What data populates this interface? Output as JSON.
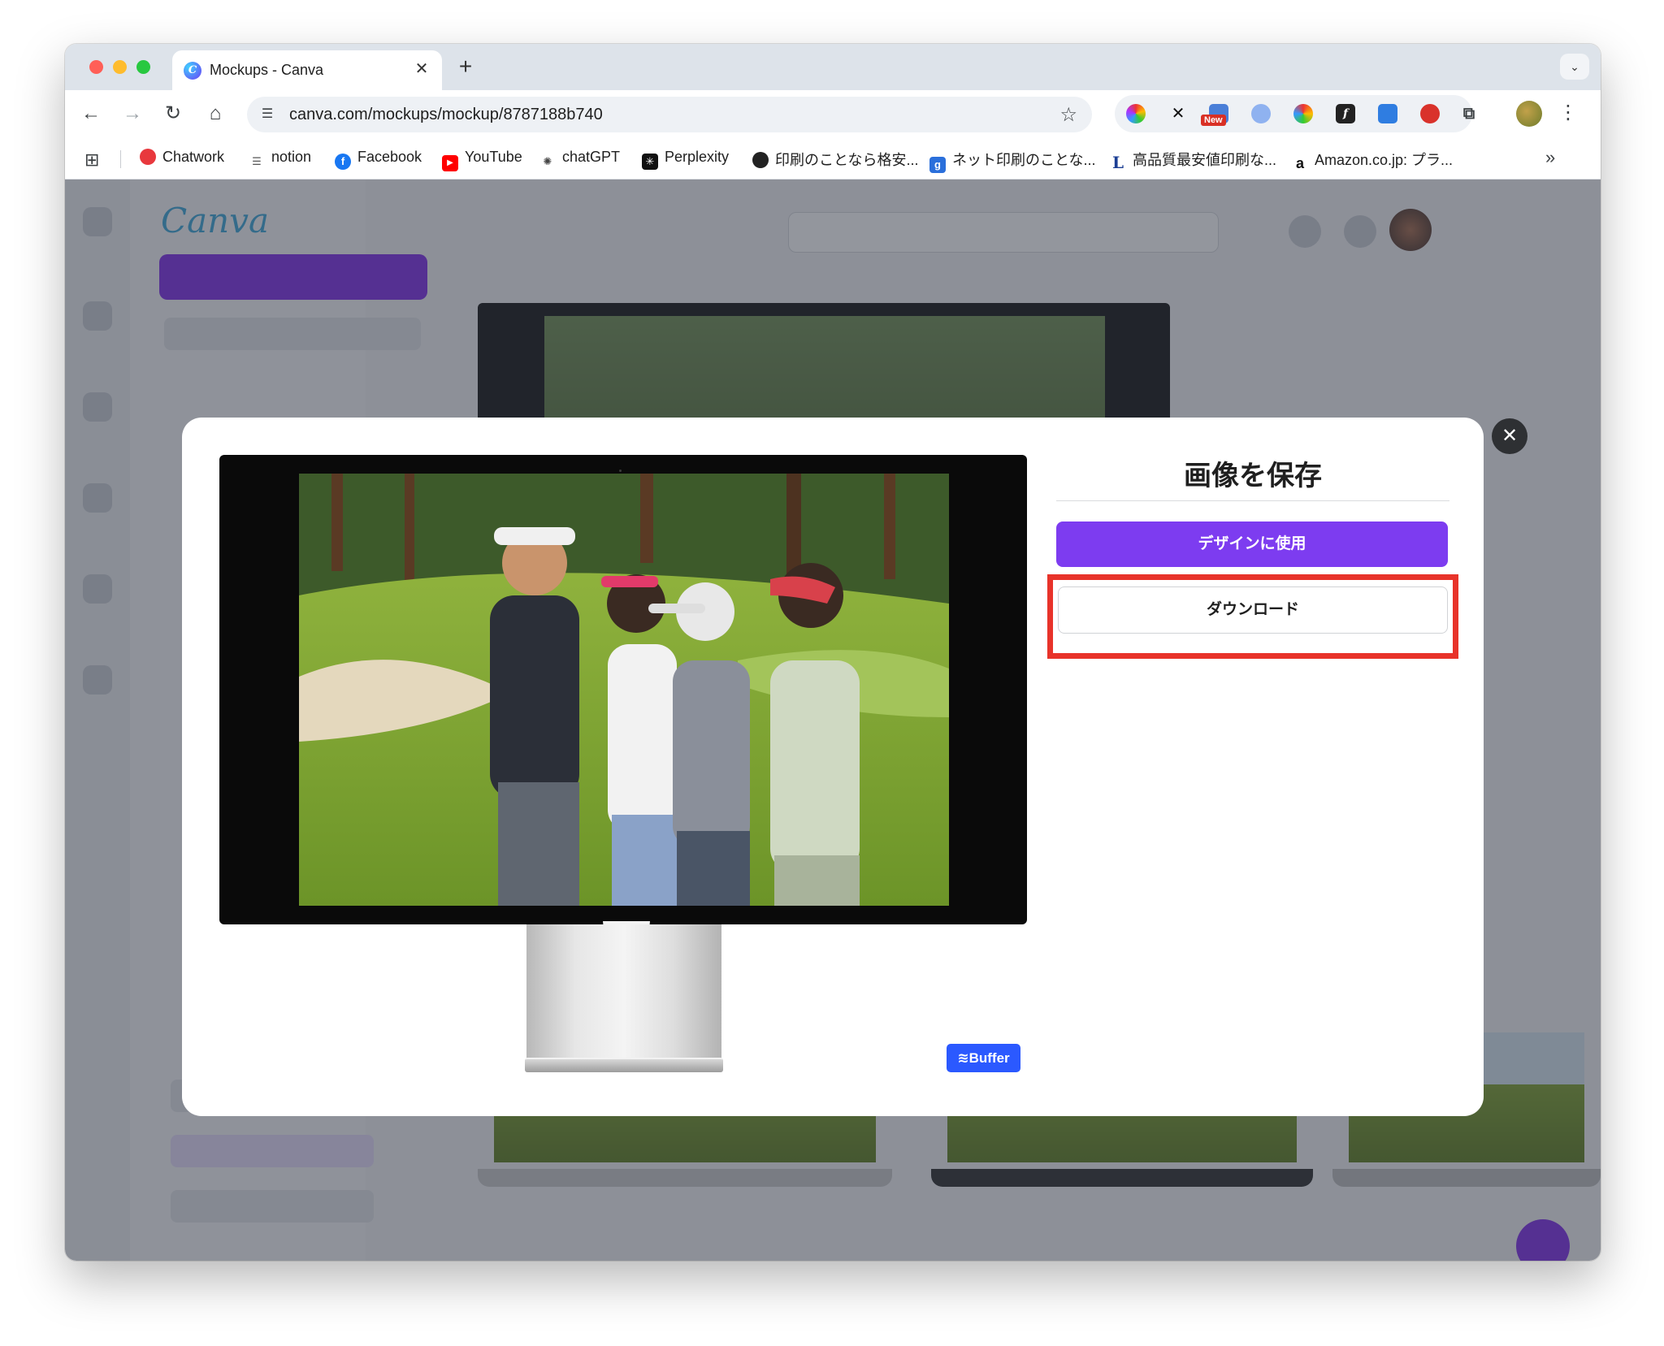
{
  "browser": {
    "tab": {
      "title": "Mockups - Canva"
    },
    "url": "canva.com/mockups/mockup/8787188b740",
    "extensions": [
      "color-picker-ext",
      "x-ext",
      "new-ext",
      "search-ext",
      "pinwheel-ext",
      "font-ext",
      "capture-ext",
      "shield-ext",
      "puzzle-ext"
    ],
    "extension_badge": "New"
  },
  "bookmarks": [
    {
      "label": "Chatwork",
      "icon": "chatwork-icon",
      "color": "#e8383d"
    },
    {
      "label": "notion",
      "icon": "notion-icon",
      "color": "#555555"
    },
    {
      "label": "Facebook",
      "icon": "facebook-icon",
      "color": "#1877f2"
    },
    {
      "label": "YouTube",
      "icon": "youtube-icon",
      "color": "#ff0000"
    },
    {
      "label": "chatGPT",
      "icon": "chatgpt-icon",
      "color": "#444444"
    },
    {
      "label": "Perplexity",
      "icon": "perplexity-icon",
      "color": "#111111"
    },
    {
      "label": "印刷のことなら格安...",
      "icon": "print-icon",
      "color": "#222222"
    },
    {
      "label": "ネット印刷のことな...",
      "icon": "netprint-icon",
      "color": "#2a6fdb"
    },
    {
      "label": "高品質最安値印刷な...",
      "icon": "l-icon",
      "color": "#1c3f94"
    },
    {
      "label": "Amazon.co.jp: プラ...",
      "icon": "amazon-icon",
      "color": "#111111"
    }
  ],
  "modal": {
    "title": "画像を保存",
    "primary_button": "デザインに使用",
    "download_button": "ダウンロード",
    "watermark": "Buffer",
    "close_symbol": "✕"
  },
  "colors": {
    "accent": "#7d3cf0",
    "highlight": "#e8332a",
    "buffer": "#2b59ff"
  }
}
